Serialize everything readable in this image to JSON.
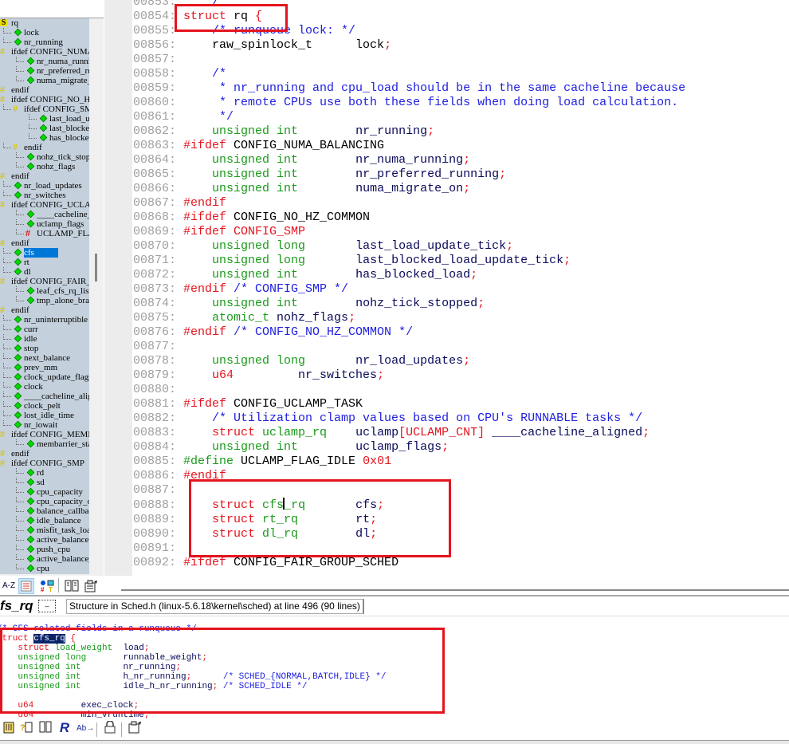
{
  "symbol_tree": {
    "items": [
      {
        "label": "rq",
        "icon": "struct-icon",
        "depth": 0
      },
      {
        "label": "lock",
        "icon": "member-icon",
        "depth": 1
      },
      {
        "label": "nr_running",
        "icon": "member-icon",
        "depth": 1
      },
      {
        "label": "ifdef CONFIG_NUMA_BALANCING",
        "icon": "preprocessor-icon",
        "depth": 0
      },
      {
        "label": "nr_numa_running",
        "icon": "member-icon",
        "depth": 2
      },
      {
        "label": "nr_preferred_running",
        "icon": "member-icon",
        "depth": 2
      },
      {
        "label": "numa_migrate_on",
        "icon": "member-icon",
        "depth": 2
      },
      {
        "label": "endif",
        "icon": "preprocessor-icon",
        "depth": 0
      },
      {
        "label": "ifdef CONFIG_NO_HZ_COMMON",
        "icon": "preprocessor-icon",
        "depth": 0
      },
      {
        "label": "ifdef CONFIG_SMP",
        "icon": "preprocessor-icon",
        "depth": 1
      },
      {
        "label": "last_load_update_tick",
        "icon": "member-icon",
        "depth": 3
      },
      {
        "label": "last_blocked_load_update_tick",
        "icon": "member-icon",
        "depth": 3
      },
      {
        "label": "has_blocked_load",
        "icon": "member-icon",
        "depth": 3
      },
      {
        "label": "endif",
        "icon": "preprocessor-icon",
        "depth": 1
      },
      {
        "label": "nohz_tick_stopped",
        "icon": "member-icon",
        "depth": 2
      },
      {
        "label": "nohz_flags",
        "icon": "member-icon",
        "depth": 2
      },
      {
        "label": "endif",
        "icon": "preprocessor-icon",
        "depth": 0
      },
      {
        "label": "nr_load_updates",
        "icon": "member-icon",
        "depth": 1
      },
      {
        "label": "nr_switches",
        "icon": "member-icon",
        "depth": 1
      },
      {
        "label": "ifdef CONFIG_UCLAMP_TASK",
        "icon": "preprocessor-icon",
        "depth": 0
      },
      {
        "label": "____cacheline_aligned",
        "icon": "member-icon",
        "depth": 2
      },
      {
        "label": "uclamp_flags",
        "icon": "member-icon",
        "depth": 2
      },
      {
        "label": "UCLAMP_FLAG_IDLE",
        "icon": "define-icon",
        "depth": 2
      },
      {
        "label": "endif",
        "icon": "preprocessor-icon",
        "depth": 0
      },
      {
        "label": "cfs",
        "icon": "member-icon",
        "depth": 1,
        "selected": true
      },
      {
        "label": "rt",
        "icon": "member-icon",
        "depth": 1
      },
      {
        "label": "dl",
        "icon": "member-icon",
        "depth": 1
      },
      {
        "label": "ifdef CONFIG_FAIR_GROUP_SCHED",
        "icon": "preprocessor-icon",
        "depth": 0
      },
      {
        "label": "leaf_cfs_rq_list",
        "icon": "member-icon",
        "depth": 2
      },
      {
        "label": "tmp_alone_branch",
        "icon": "member-icon",
        "depth": 2
      },
      {
        "label": "endif",
        "icon": "preprocessor-icon",
        "depth": 0
      },
      {
        "label": "nr_uninterruptible",
        "icon": "member-icon",
        "depth": 1
      },
      {
        "label": "curr",
        "icon": "member-icon",
        "depth": 1
      },
      {
        "label": "idle",
        "icon": "member-icon",
        "depth": 1
      },
      {
        "label": "stop",
        "icon": "member-icon",
        "depth": 1
      },
      {
        "label": "next_balance",
        "icon": "member-icon",
        "depth": 1
      },
      {
        "label": "prev_mm",
        "icon": "member-icon",
        "depth": 1
      },
      {
        "label": "clock_update_flags",
        "icon": "member-icon",
        "depth": 1
      },
      {
        "label": "clock",
        "icon": "member-icon",
        "depth": 1
      },
      {
        "label": "____cacheline_aligned",
        "icon": "member-icon",
        "depth": 1
      },
      {
        "label": "clock_pelt",
        "icon": "member-icon",
        "depth": 1
      },
      {
        "label": "lost_idle_time",
        "icon": "member-icon",
        "depth": 1
      },
      {
        "label": "nr_iowait",
        "icon": "member-icon",
        "depth": 1
      },
      {
        "label": "ifdef CONFIG_MEMBARRIER",
        "icon": "preprocessor-icon",
        "depth": 0
      },
      {
        "label": "membarrier_state",
        "icon": "member-icon",
        "depth": 2
      },
      {
        "label": "endif",
        "icon": "preprocessor-icon",
        "depth": 0
      },
      {
        "label": "ifdef CONFIG_SMP",
        "icon": "preprocessor-icon",
        "depth": 0
      },
      {
        "label": "rd",
        "icon": "member-icon",
        "depth": 2
      },
      {
        "label": "sd",
        "icon": "member-icon",
        "depth": 2
      },
      {
        "label": "cpu_capacity",
        "icon": "member-icon",
        "depth": 2
      },
      {
        "label": "cpu_capacity_orig",
        "icon": "member-icon",
        "depth": 2
      },
      {
        "label": "balance_callback",
        "icon": "member-icon",
        "depth": 2
      },
      {
        "label": "idle_balance",
        "icon": "member-icon",
        "depth": 2
      },
      {
        "label": "misfit_task_load",
        "icon": "member-icon",
        "depth": 2
      },
      {
        "label": "active_balance",
        "icon": "member-icon",
        "depth": 2
      },
      {
        "label": "push_cpu",
        "icon": "member-icon",
        "depth": 2
      },
      {
        "label": "active_balance_work",
        "icon": "member-icon",
        "depth": 2
      },
      {
        "label": "cpu",
        "icon": "member-icon",
        "depth": 2
      }
    ]
  },
  "tree_toolbar": {
    "az_label": "A-Z",
    "buttons": [
      "sort-alpha",
      "outline-view",
      "symbol-types",
      "book",
      "properties"
    ]
  },
  "editor": {
    "lines": [
      {
        "n": "00853:",
        "segs": [
          [
            "cm",
            "    */"
          ]
        ]
      },
      {
        "n": "00854:",
        "segs": [
          [
            "kw",
            " struct "
          ],
          [
            "id",
            "rq "
          ],
          [
            "kw",
            "{"
          ]
        ]
      },
      {
        "n": "00855:",
        "segs": [
          [
            "cm",
            "     /* runqueue lock: */"
          ]
        ]
      },
      {
        "n": "00856:",
        "segs": [
          [
            "id",
            "     raw_spinlock_t      lock"
          ],
          [
            "kw",
            ";"
          ]
        ]
      },
      {
        "n": "00857:",
        "segs": []
      },
      {
        "n": "00858:",
        "segs": [
          [
            "cm",
            "     /*"
          ]
        ]
      },
      {
        "n": "00859:",
        "segs": [
          [
            "cm",
            "      * nr_running and cpu_load should be in the same cacheline because"
          ]
        ]
      },
      {
        "n": "00860:",
        "segs": [
          [
            "cm",
            "      * remote CPUs use both these fields when doing load calculation."
          ]
        ]
      },
      {
        "n": "00861:",
        "segs": [
          [
            "cm",
            "      */"
          ]
        ]
      },
      {
        "n": "00862:",
        "segs": [
          [
            "ty",
            "     unsigned int        "
          ],
          [
            "nv",
            "nr_running"
          ],
          [
            "kw",
            ";"
          ]
        ]
      },
      {
        "n": "00863:",
        "segs": [
          [
            "pre",
            " #ifdef "
          ],
          [
            "id",
            "CONFIG_NUMA_BALANCING"
          ]
        ]
      },
      {
        "n": "00864:",
        "segs": [
          [
            "ty",
            "     unsigned int        "
          ],
          [
            "nv",
            "nr_numa_running"
          ],
          [
            "kw",
            ";"
          ]
        ]
      },
      {
        "n": "00865:",
        "segs": [
          [
            "ty",
            "     unsigned int        "
          ],
          [
            "nv",
            "nr_preferred_running"
          ],
          [
            "kw",
            ";"
          ]
        ]
      },
      {
        "n": "00866:",
        "segs": [
          [
            "ty",
            "     unsigned int        "
          ],
          [
            "nv",
            "numa_migrate_on"
          ],
          [
            "kw",
            ";"
          ]
        ]
      },
      {
        "n": "00867:",
        "segs": [
          [
            "pre",
            " #endif"
          ]
        ]
      },
      {
        "n": "00868:",
        "segs": [
          [
            "pre",
            " #ifdef "
          ],
          [
            "id",
            "CONFIG_NO_HZ_COMMON"
          ]
        ]
      },
      {
        "n": "00869:",
        "segs": [
          [
            "pre",
            " #ifdef CONFIG_SMP"
          ]
        ]
      },
      {
        "n": "00870:",
        "segs": [
          [
            "ty",
            "     unsigned long       "
          ],
          [
            "nv",
            "last_load_update_tick"
          ],
          [
            "kw",
            ";"
          ]
        ]
      },
      {
        "n": "00871:",
        "segs": [
          [
            "ty",
            "     unsigned long       "
          ],
          [
            "nv",
            "last_blocked_load_update_tick"
          ],
          [
            "kw",
            ";"
          ]
        ]
      },
      {
        "n": "00872:",
        "segs": [
          [
            "ty",
            "     unsigned int        "
          ],
          [
            "nv",
            "has_blocked_load"
          ],
          [
            "kw",
            ";"
          ]
        ]
      },
      {
        "n": "00873:",
        "segs": [
          [
            "pre",
            " #endif "
          ],
          [
            "cm",
            "/* CONFIG_SMP */"
          ]
        ]
      },
      {
        "n": "00874:",
        "segs": [
          [
            "ty",
            "     unsigned int        "
          ],
          [
            "nv",
            "nohz_tick_stopped"
          ],
          [
            "kw",
            ";"
          ]
        ]
      },
      {
        "n": "00875:",
        "segs": [
          [
            "ty",
            "     atomic_t "
          ],
          [
            "nv",
            "nohz_flags"
          ],
          [
            "kw",
            ";"
          ]
        ]
      },
      {
        "n": "00876:",
        "segs": [
          [
            "pre",
            " #endif "
          ],
          [
            "cm",
            "/* CONFIG_NO_HZ_COMMON */"
          ]
        ]
      },
      {
        "n": "00877:",
        "segs": []
      },
      {
        "n": "00878:",
        "segs": [
          [
            "ty",
            "     unsigned long       "
          ],
          [
            "nv",
            "nr_load_updates"
          ],
          [
            "kw",
            ";"
          ]
        ]
      },
      {
        "n": "00879:",
        "segs": [
          [
            "kw",
            "     u64         "
          ],
          [
            "nv",
            "nr_switches"
          ],
          [
            "kw",
            ";"
          ]
        ]
      },
      {
        "n": "00880:",
        "segs": []
      },
      {
        "n": "00881:",
        "segs": [
          [
            "pre",
            " #ifdef "
          ],
          [
            "id",
            "CONFIG_UCLAMP_TASK"
          ]
        ]
      },
      {
        "n": "00882:",
        "segs": [
          [
            "cm",
            "     /* Utilization clamp values based on CPU's RUNNABLE tasks */"
          ]
        ]
      },
      {
        "n": "00883:",
        "segs": [
          [
            "kw",
            "     struct "
          ],
          [
            "ty",
            "uclamp_rq    "
          ],
          [
            "nv",
            "uclamp"
          ],
          [
            "kw",
            "[UCLAMP_CNT]"
          ],
          [
            "nv",
            " ____cacheline_aligned"
          ],
          [
            "kw",
            ";"
          ]
        ]
      },
      {
        "n": "00884:",
        "segs": [
          [
            "ty",
            "     unsigned int        "
          ],
          [
            "nv",
            "uclamp_flags"
          ],
          [
            "kw",
            ";"
          ]
        ]
      },
      {
        "n": "00885:",
        "segs": [
          [
            "ty",
            " #define "
          ],
          [
            "id",
            "UCLAMP_FLAG_IDLE "
          ],
          [
            "num",
            "0x01"
          ]
        ]
      },
      {
        "n": "00886:",
        "segs": [
          [
            "pre",
            " #endif"
          ]
        ]
      },
      {
        "n": "00887:",
        "segs": []
      },
      {
        "n": "00888:",
        "segs": [
          [
            "kw",
            "     struct "
          ],
          [
            "ty",
            "cfs_rq       "
          ],
          [
            "nv",
            "cfs"
          ],
          [
            "kw",
            ";"
          ]
        ]
      },
      {
        "n": "00889:",
        "segs": [
          [
            "kw",
            "     struct "
          ],
          [
            "ty",
            "rt_rq        "
          ],
          [
            "nv",
            "rt"
          ],
          [
            "kw",
            ";"
          ]
        ]
      },
      {
        "n": "00890:",
        "segs": [
          [
            "kw",
            "     struct "
          ],
          [
            "ty",
            "dl_rq        "
          ],
          [
            "nv",
            "dl"
          ],
          [
            "kw",
            ";"
          ]
        ]
      },
      {
        "n": "00891:",
        "segs": []
      },
      {
        "n": "00892:",
        "segs": [
          [
            "pre",
            " #ifdef "
          ],
          [
            "id",
            "CONFIG_FAIR_GROUP_SCHED"
          ]
        ]
      }
    ]
  },
  "context": {
    "symbol_name": "fs_rq",
    "description": "Structure in Sched.h (linux-5.6.18\\kernel\\sched) at line 496 (90 lines)"
  },
  "preview": {
    "lines": [
      [
        [
          "cm",
          "/* CFS-related fields in a runqueue */"
        ]
      ],
      [
        [
          "kw",
          "struct "
        ],
        [
          "hl",
          "cfs_rq"
        ],
        [
          "kw",
          " {"
        ]
      ],
      [
        [
          "kw",
          "    struct "
        ],
        [
          "ty",
          "load_weight  "
        ],
        [
          "nv",
          "load"
        ],
        [
          "kw",
          ";"
        ]
      ],
      [
        [
          "ty",
          "    unsigned long       "
        ],
        [
          "nv",
          "runnable_weight"
        ],
        [
          "kw",
          ";"
        ]
      ],
      [
        [
          "ty",
          "    unsigned int        "
        ],
        [
          "nv",
          "nr_running"
        ],
        [
          "kw",
          ";"
        ]
      ],
      [
        [
          "ty",
          "    unsigned int        "
        ],
        [
          "nv",
          "h_nr_running"
        ],
        [
          "kw",
          ";      "
        ],
        [
          "cm",
          "/* SCHED_{NORMAL,BATCH,IDLE} */"
        ]
      ],
      [
        [
          "ty",
          "    unsigned int        "
        ],
        [
          "nv",
          "idle_h_nr_running"
        ],
        [
          "kw",
          "; "
        ],
        [
          "cm",
          "/* SCHED_IDLE */"
        ]
      ],
      [],
      [
        [
          "kw",
          "    u64         "
        ],
        [
          "nv",
          "exec_clock"
        ],
        [
          "kw",
          ";"
        ]
      ],
      [
        [
          "kw",
          "    u64         "
        ],
        [
          "nv",
          "min_vruntime"
        ],
        [
          "kw",
          ";"
        ]
      ]
    ]
  },
  "bottom_toolbar": {
    "buttons": [
      "jump-to-definition",
      "info",
      "book",
      "reference",
      "rename",
      "lock",
      "properties"
    ]
  }
}
